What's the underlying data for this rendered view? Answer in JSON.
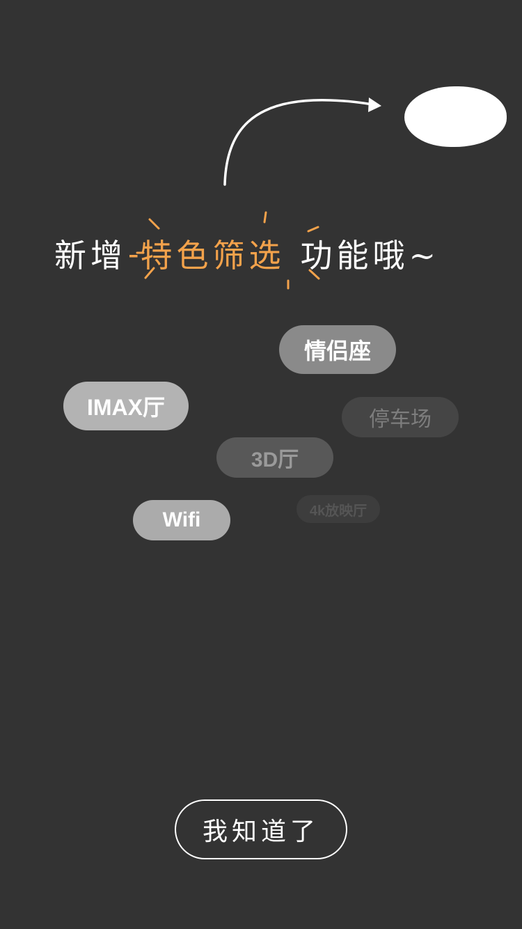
{
  "guide": {
    "headline_prefix": "新增",
    "headline_feature": "特色筛选",
    "headline_suffix": "功能哦~",
    "dash": "-",
    "accent_color": "#f3a24b",
    "background_color": "#333333"
  },
  "chips": {
    "couple": "情侣座",
    "imax": "IMAX厅",
    "parking": "停车场",
    "three_d": "3D厅",
    "wifi": "Wifi",
    "four_k": "4k放映厅"
  },
  "button": {
    "label": "我知道了"
  },
  "icons": {
    "arrow": "curved-arrow-icon",
    "sparkle": "sparkle-burst-icon"
  }
}
